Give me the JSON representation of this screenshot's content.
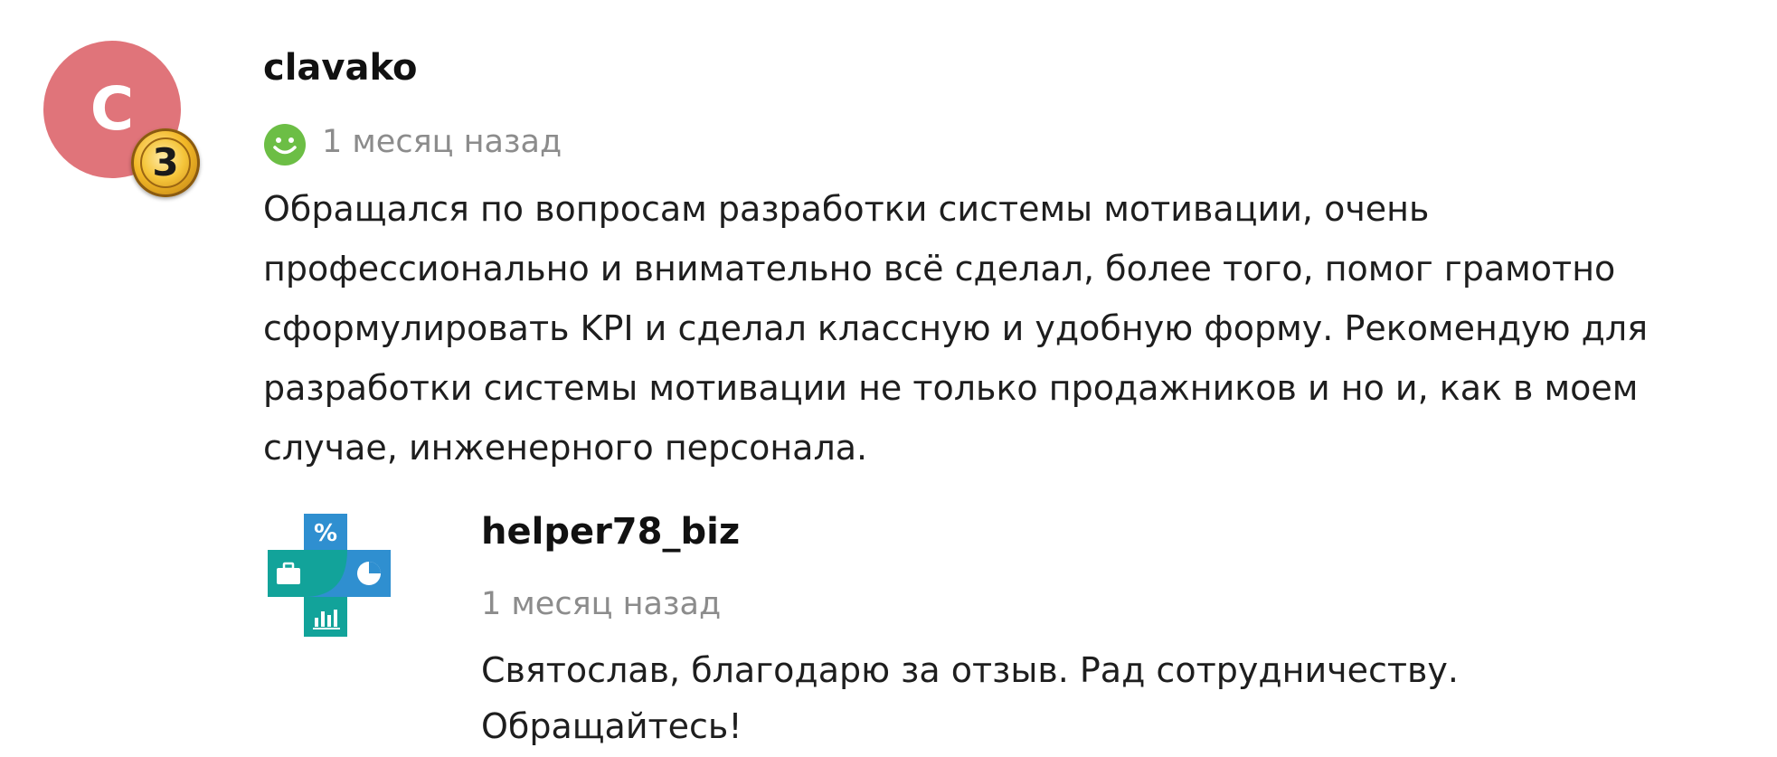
{
  "review": {
    "avatar_letter": "C",
    "level": "3",
    "username": "clavako",
    "rating_icon": "smiley-face-icon",
    "time": "1 месяц назад",
    "text": "Обращался по вопросам разработки системы мотивации, очень профессионально и внимательно всё сделал, более того, помог грамотно сформулировать KPI и сделал классную и удобную форму. Рекомендую для разработки системы мотивации не только продажников и но и, как в моем случае, инженерного персонала."
  },
  "reply": {
    "username": "helper78_biz",
    "time": "1 месяц назад",
    "text": "Святослав, благодарю за отзыв. Рад сотрудничеству. Обращайтесь!"
  },
  "colors": {
    "avatar_bg": "#e0747a",
    "positive_rating": "#6cbe45",
    "muted_text": "#8c8c8c",
    "logo_blue": "#2f8fd0",
    "logo_teal": "#12a39a"
  }
}
